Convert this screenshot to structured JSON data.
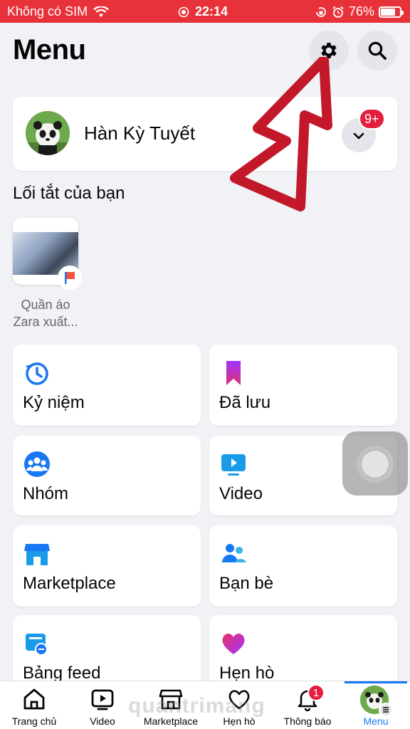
{
  "status_bar": {
    "carrier": "Không có SIM",
    "time": "22:14",
    "battery": "76%",
    "battery_level": 0.76
  },
  "header": {
    "title": "Menu",
    "settings_icon": "gear-icon",
    "search_icon": "search-icon"
  },
  "profile": {
    "name": "Hàn Kỳ Tuyết",
    "notification_badge": "9+"
  },
  "shortcuts": {
    "title": "Lối tắt của bạn",
    "items": [
      {
        "label_line1": "Quần áo",
        "label_line2": "Zara xuất..."
      }
    ]
  },
  "tiles": [
    {
      "label": "Kỷ niệm",
      "icon": "memories-clock-icon"
    },
    {
      "label": "Đã lưu",
      "icon": "saved-bookmark-icon"
    },
    {
      "label": "Nhóm",
      "icon": "groups-icon"
    },
    {
      "label": "Video",
      "icon": "video-icon"
    },
    {
      "label": "Marketplace",
      "icon": "marketplace-store-icon"
    },
    {
      "label": "Bạn bè",
      "icon": "friends-icon"
    },
    {
      "label": "Bảng feed",
      "icon": "feeds-icon"
    },
    {
      "label": "Hẹn hò",
      "icon": "dating-heart-icon"
    }
  ],
  "bottom_nav": [
    {
      "label": "Trang chủ",
      "icon": "home-icon"
    },
    {
      "label": "Video",
      "icon": "video-play-icon"
    },
    {
      "label": "Marketplace",
      "icon": "store-icon"
    },
    {
      "label": "Hẹn hò",
      "icon": "heart-icon"
    },
    {
      "label": "Thông báo",
      "icon": "bell-icon",
      "badge": "1"
    },
    {
      "label": "Menu",
      "icon": "menu-avatar-icon",
      "active": true
    }
  ],
  "watermark": "quantrimang",
  "colors": {
    "status_bar": "#e8323a",
    "accent": "#1877f2",
    "badge": "#e41e3f",
    "background": "#f0f2f5"
  }
}
